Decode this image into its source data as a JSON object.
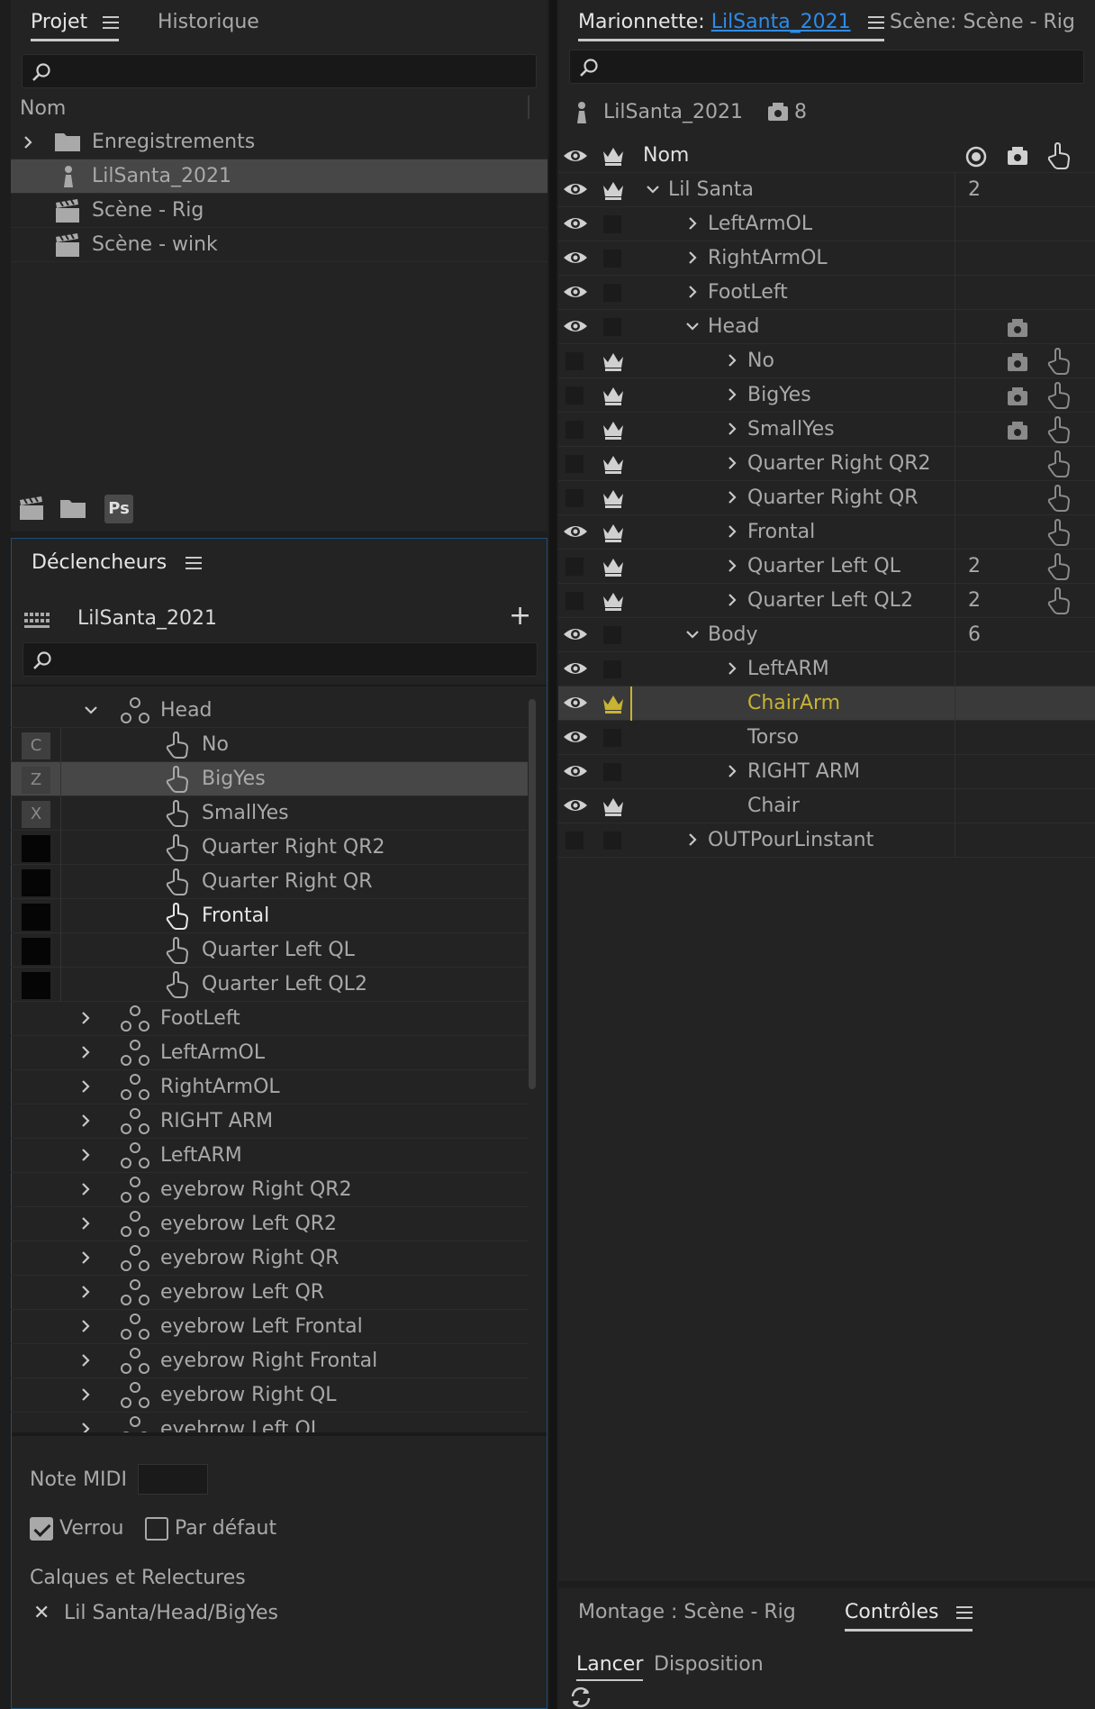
{
  "project_panel": {
    "tabs": [
      "Projet",
      "Historique"
    ],
    "column_header": "Nom",
    "items": [
      {
        "label": "Enregistrements",
        "icon": "folder-icon",
        "expandable": true
      },
      {
        "label": "LilSanta_2021",
        "icon": "puppet-icon",
        "selected": true
      },
      {
        "label": "Scène - Rig",
        "icon": "clapper-icon"
      },
      {
        "label": "Scène - wink",
        "icon": "clapper-icon"
      }
    ],
    "footer_ps": "Ps"
  },
  "triggers_panel": {
    "title": "Déclencheurs",
    "puppet_name": "LilSanta_2021",
    "rows": [
      {
        "type": "group",
        "label": "Head",
        "expanded": true
      },
      {
        "type": "trigger",
        "key": "C",
        "label": "No"
      },
      {
        "type": "trigger",
        "key": "Z",
        "label": "BigYes",
        "selected": true
      },
      {
        "type": "trigger",
        "key": "X",
        "label": "SmallYes"
      },
      {
        "type": "trigger",
        "key": "",
        "label": "Quarter Right QR2"
      },
      {
        "type": "trigger",
        "key": "",
        "label": "Quarter Right QR"
      },
      {
        "type": "trigger",
        "key": "",
        "label": "Frontal",
        "bright": true
      },
      {
        "type": "trigger",
        "key": "",
        "label": "Quarter Left QL"
      },
      {
        "type": "trigger",
        "key": "",
        "label": "Quarter Left QL2"
      },
      {
        "type": "group",
        "label": "FootLeft"
      },
      {
        "type": "group",
        "label": "LeftArmOL"
      },
      {
        "type": "group",
        "label": "RightArmOL"
      },
      {
        "type": "group",
        "label": "RIGHT ARM"
      },
      {
        "type": "group",
        "label": "LeftARM"
      },
      {
        "type": "group",
        "label": "eyebrow Right QR2"
      },
      {
        "type": "group",
        "label": "eyebrow Left QR2"
      },
      {
        "type": "group",
        "label": "eyebrow Right QR"
      },
      {
        "type": "group",
        "label": "eyebrow Left QR"
      },
      {
        "type": "group",
        "label": "eyebrow Left Frontal"
      },
      {
        "type": "group",
        "label": "eyebrow Right Frontal"
      },
      {
        "type": "group",
        "label": "eyebrow Right QL"
      },
      {
        "type": "group",
        "label": "eyebrow Left QL"
      }
    ],
    "midi_label": "Note MIDI",
    "latch_label": "Verrou",
    "latch_checked": true,
    "default_label": "Par défaut",
    "default_checked": false,
    "layers_title": "Calques et Relectures",
    "layer_path": "Lil Santa/Head/BigYes"
  },
  "puppet_panel": {
    "tab_prefix": "Marionnette: ",
    "tab_name": "LilSanta_2021",
    "scene_tab": "Scène: Scène - Rig",
    "puppet_name": "LilSanta_2021",
    "camera_count": "8",
    "column_name": "Nom",
    "rows": [
      {
        "label": "Lil Santa",
        "eye": true,
        "crown": true,
        "chevron": "down",
        "count": "2"
      },
      {
        "label": "LeftArmOL",
        "eye": true,
        "crown": false,
        "chevron": "right"
      },
      {
        "label": "RightArmOL",
        "eye": true,
        "crown": false,
        "chevron": "right"
      },
      {
        "label": "FootLeft",
        "eye": true,
        "crown": false,
        "chevron": "right"
      },
      {
        "label": "Head",
        "eye": true,
        "crown": false,
        "chevron": "down",
        "camera": true
      },
      {
        "label": "No",
        "eye": false,
        "crown": true,
        "chevron": "right",
        "camera": true,
        "hand": true
      },
      {
        "label": "BigYes",
        "eye": false,
        "crown": true,
        "chevron": "right",
        "camera": true,
        "hand": true
      },
      {
        "label": "SmallYes",
        "eye": false,
        "crown": true,
        "chevron": "right",
        "camera": true,
        "hand": true
      },
      {
        "label": "Quarter Right QR2",
        "eye": false,
        "crown": true,
        "chevron": "right",
        "hand": true
      },
      {
        "label": "Quarter Right QR",
        "eye": false,
        "crown": true,
        "chevron": "right",
        "hand": true
      },
      {
        "label": "Frontal",
        "eye": true,
        "crown": true,
        "chevron": "right",
        "hand": true
      },
      {
        "label": "Quarter Left QL",
        "eye": false,
        "crown": true,
        "chevron": "right",
        "count": "2",
        "hand": true
      },
      {
        "label": "Quarter Left QL2",
        "eye": false,
        "crown": true,
        "chevron": "right",
        "count": "2",
        "hand": true
      },
      {
        "label": "Body",
        "eye": true,
        "crown": false,
        "chevron": "down",
        "count": "6"
      },
      {
        "label": "LeftARM",
        "eye": true,
        "crown": false,
        "chevron": "right"
      },
      {
        "label": "ChairArm",
        "eye": true,
        "crown": true,
        "chevron": "",
        "selected": true
      },
      {
        "label": "Torso",
        "eye": true,
        "crown": false,
        "chevron": ""
      },
      {
        "label": "RIGHT ARM",
        "eye": true,
        "crown": false,
        "chevron": "right"
      },
      {
        "label": "Chair",
        "eye": true,
        "crown": true,
        "chevron": ""
      },
      {
        "label": "OUTPourLinstant",
        "eye": false,
        "crown": false,
        "chevron": "right"
      }
    ]
  },
  "bottom_panel": {
    "tabs": [
      "Montage : Scène - Rig",
      "Contrôles"
    ],
    "subtabs": [
      "Lancer",
      "Disposition"
    ]
  },
  "colors": {
    "accent_blue": "#2d8ceb",
    "selected_yellow": "#c8b332",
    "panel_bg": "#232323"
  }
}
